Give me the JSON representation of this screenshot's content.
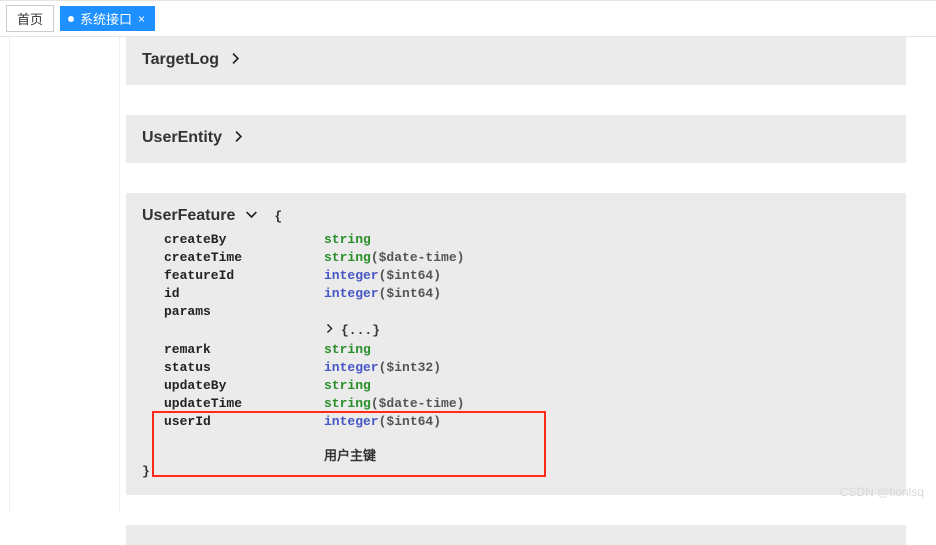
{
  "tabs": {
    "home": "首页",
    "active": "系统接口"
  },
  "models": {
    "targetLog": {
      "name": "TargetLog"
    },
    "userEntity": {
      "name": "UserEntity"
    },
    "userFeature": {
      "name": "UserFeature",
      "fields": {
        "createBy": {
          "type": "string",
          "fmt": ""
        },
        "createTime": {
          "type": "string",
          "fmt": "($date-time)"
        },
        "featureId": {
          "type": "integer",
          "fmt": "($int64)"
        },
        "id": {
          "type": "integer",
          "fmt": "($int64)"
        },
        "params": {
          "type": "",
          "fmt": ""
        },
        "nested": "{...}",
        "remark": {
          "type": "string",
          "fmt": ""
        },
        "status": {
          "type": "integer",
          "fmt": "($int32)"
        },
        "updateBy": {
          "type": "string",
          "fmt": ""
        },
        "updateTime": {
          "type": "string",
          "fmt": "($date-time)"
        },
        "userId": {
          "type": "integer",
          "fmt": "($int64)",
          "desc": "用户主键"
        }
      }
    }
  },
  "watermark": "CSDN @fionlsq"
}
